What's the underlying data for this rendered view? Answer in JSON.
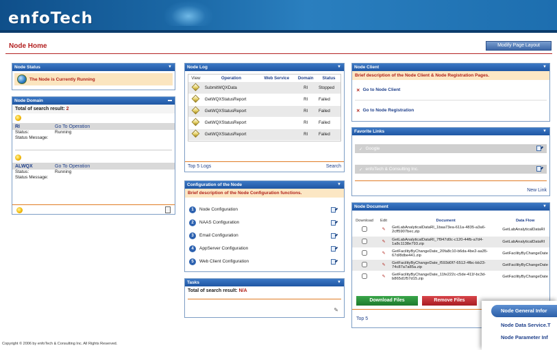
{
  "header": {
    "logo_text": "enfoTech"
  },
  "page": {
    "title": "Node Home",
    "modify_layout_label": "Modify Page Layout"
  },
  "node_status": {
    "title": "Node Status",
    "message": "The Node is Currently Running"
  },
  "node_domain": {
    "title": "Node Domain",
    "total_label": "Total of search result:",
    "total_value": "2",
    "domains": [
      {
        "name": "RI",
        "link": "Go To Operation",
        "status_label": "Status:",
        "status": "Running",
        "message_label": "Status Message:"
      },
      {
        "name": "ALWQX",
        "link": "Go To Operation",
        "status_label": "Status:",
        "status": "Running",
        "message_label": "Status Message:"
      }
    ]
  },
  "node_log": {
    "title": "Node Log",
    "columns": [
      "View",
      "Operation",
      "Web Service",
      "Domain",
      "Status"
    ],
    "rows": [
      {
        "operation": "SubmitWQXData",
        "web_service": "",
        "domain": "RI",
        "status": "Stopped"
      },
      {
        "operation": "GetWQXStatusReport",
        "web_service": "",
        "domain": "RI",
        "status": "Failed"
      },
      {
        "operation": "GetWQXStatusReport",
        "web_service": "",
        "domain": "RI",
        "status": "Failed"
      },
      {
        "operation": "GetWQXStatusReport",
        "web_service": "",
        "domain": "RI",
        "status": "Failed"
      },
      {
        "operation": "GetWQXStatusReport",
        "web_service": "",
        "domain": "RI",
        "status": "Failed"
      }
    ],
    "footer_left": "Top 5 Logs",
    "footer_right": "Search"
  },
  "config": {
    "title": "Configuration of the Node",
    "description": "Brief description of the Node Configuration functions.",
    "items": [
      {
        "num": "1",
        "label": "Node Configuration"
      },
      {
        "num": "2",
        "label": "NAAS Configuration"
      },
      {
        "num": "3",
        "label": "Email Configuration"
      },
      {
        "num": "4",
        "label": "AppServer Configuration"
      },
      {
        "num": "5",
        "label": "Web Client Configuration"
      }
    ]
  },
  "tasks": {
    "title": "Tasks",
    "total_label": "Total of search result:",
    "total_value": "N/A"
  },
  "node_client": {
    "title": "Node Client",
    "description": "Brief description of the Node Client & Node Registration Pages.",
    "links": [
      "Go to Node Client",
      "Go to Node Registration"
    ]
  },
  "favorites": {
    "title": "Favorite Links",
    "items": [
      "Google",
      "enfoTech & Consulting Inc."
    ],
    "new_link": "New Link"
  },
  "documents": {
    "title": "Node Document",
    "columns": [
      "Download",
      "Edit",
      "Document",
      "Data Flow"
    ],
    "rows": [
      {
        "document": "GetLabAnalyticalDataRI_1baa73ea-611a-4835-a3a6-2cff5907bec.zip",
        "flow": "GetLabAnalyticalDataRI"
      },
      {
        "document": "GetLabAnalyticalDataRI_7f947d0c-c120-44fb-a7d4-1a8c1138e793.zip",
        "flow": "GetLabAnalyticalDataRI"
      },
      {
        "document": "GetFacilityByChangeDate_20fa8c10-b6da-4be2-aa35-67d/8dbe441.zip",
        "flow": "GetFacilityByChangeDate"
      },
      {
        "document": "GetFacilityByChangeDate_f593d0f7-6512-4fbc-bb23-74c87a7a85a.zip",
        "flow": "GetFacilityByChangeDate"
      },
      {
        "document": "GetFacilityByChangeDate_11fe222c-c5de-411f-bc3d-b865d1f57d15.zip",
        "flow": "GetFacilityByChangeDate"
      }
    ],
    "download_label": "Download Files",
    "remove_label": "Remove Files",
    "top_label": "Top 5"
  },
  "popup_menu": {
    "items": [
      "Node General Infor",
      "Node Data Service.T",
      "Node Parameter Inf"
    ]
  },
  "footer": {
    "copyright": "Copyright © 2006 by enfoTech & Consulting Inc. All Rights Reserved."
  },
  "colors": {
    "accent_red": "#b32020",
    "header_blue": "#1f56a3",
    "desc_bg": "#fce7c4"
  }
}
